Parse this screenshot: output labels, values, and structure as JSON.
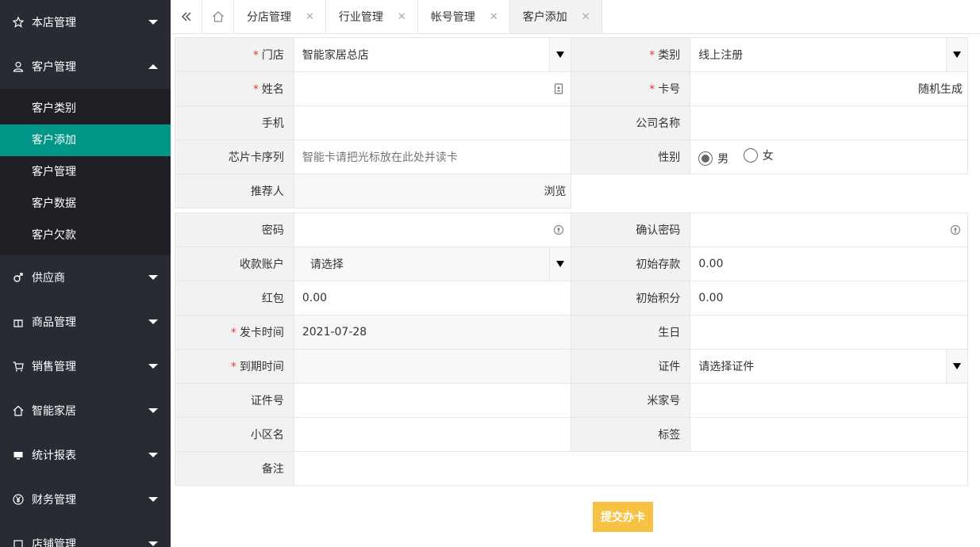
{
  "sidebar": {
    "items": [
      {
        "label": "本店管理",
        "icon": "star-icon"
      },
      {
        "label": "客户管理",
        "icon": "user-icon"
      },
      {
        "label": "供应商",
        "icon": "male-icon"
      },
      {
        "label": "商品管理",
        "icon": "gift-icon"
      },
      {
        "label": "销售管理",
        "icon": "cart-icon"
      },
      {
        "label": "智能家居",
        "icon": "home-icon"
      },
      {
        "label": "统计报表",
        "icon": "monitor-icon"
      },
      {
        "label": "财务管理",
        "icon": "yen-icon"
      },
      {
        "label": "店铺管理",
        "icon": "store-icon"
      }
    ],
    "submenu": [
      "客户类别",
      "客户添加",
      "客户管理",
      "客户数据",
      "客户欠款"
    ]
  },
  "tabs": [
    "分店管理",
    "行业管理",
    "帐号管理",
    "客户添加"
  ],
  "form1": {
    "store_label": "门店",
    "store_value": "智能家居总店",
    "category_label": "类别",
    "category_value": "线上注册",
    "name_label": "姓名",
    "card_label": "卡号",
    "card_value": "随机生成",
    "phone_label": "手机",
    "company_label": "公司名称",
    "chip_label": "芯片卡序列",
    "chip_placeholder": "智能卡请把光标放在此处并读卡",
    "gender_label": "性别",
    "gender_male": "男",
    "gender_female": "女",
    "referrer_label": "推荐人",
    "browse_label": "浏览"
  },
  "form2": {
    "password_label": "密码",
    "confirm_label": "确认密码",
    "account_label": "收款账户",
    "account_value": "请选择",
    "deposit_label": "初始存款",
    "deposit_value": "0.00",
    "redpack_label": "红包",
    "redpack_value": "0.00",
    "points_label": "初始积分",
    "points_value": "0.00",
    "issue_label": "发卡时间",
    "issue_value": "2021-07-28",
    "birthday_label": "生日",
    "expire_label": "到期时间",
    "cert_label": "证件",
    "cert_value": "请选择证件",
    "certno_label": "证件号",
    "mijia_label": "米家号",
    "community_label": "小区名",
    "tag_label": "标签",
    "remark_label": "备注"
  },
  "submit_label": "提交办卡"
}
